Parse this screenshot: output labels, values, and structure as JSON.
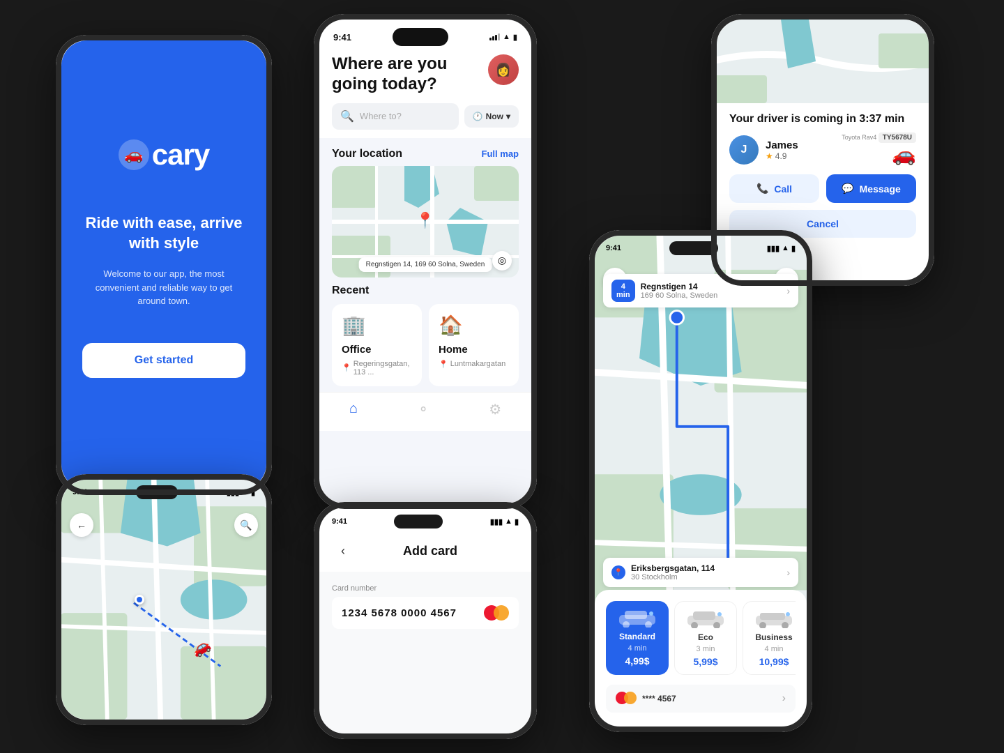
{
  "app": {
    "name": "cary"
  },
  "splash": {
    "tagline": "Ride with ease,\narrive with style",
    "subtitle": "Welcome to our app, the most convenient and reliable way to get around town.",
    "cta": "Get started"
  },
  "home": {
    "greeting": "Where are you\ngoing today?",
    "search_placeholder": "Where to?",
    "now_label": "Now",
    "location_title": "Your location",
    "full_map": "Full map",
    "address": "Regnstigen 14, 169 60 Solna, Sweden",
    "recent_title": "Recent",
    "recent_items": [
      {
        "icon": "🏢",
        "name": "Office",
        "address": "Regeringsgatan, 113 ..."
      },
      {
        "icon": "🏠",
        "name": "Home",
        "address": "Luntmakargatan"
      }
    ]
  },
  "driver_screen": {
    "title": "Your driver is coming in 3:37 min",
    "driver_name": "James",
    "driver_rating": "4.9",
    "car_model": "Toyota Rav4",
    "plate": "TY5678U",
    "call_label": "Call",
    "message_label": "Message",
    "cancel_label": "Cancel"
  },
  "route_screen": {
    "origin_street": "Regnstigen 14",
    "origin_city": "169 60 Solna, Sweden",
    "dest_street": "Eriksbergsgatan, 114",
    "dest_city": "30 Stockholm",
    "eta_minutes": "4",
    "eta_unit": "min",
    "vehicles": [
      {
        "name": "Standard",
        "time": "4 min",
        "price": "4,99$",
        "selected": true
      },
      {
        "name": "Eco",
        "time": "3 min",
        "price": "5,99$",
        "selected": false
      },
      {
        "name": "Business",
        "time": "4 min",
        "price": "10,99$",
        "selected": false
      }
    ],
    "card_number": "**** 4567"
  },
  "addcard": {
    "title": "Add card",
    "field_label": "Card number",
    "card_number": "1234 5678 0000 4567"
  },
  "status_bar": {
    "time": "9:41",
    "signal": "●●●",
    "wifi": "wifi",
    "battery": "battery"
  },
  "colors": {
    "primary": "#2563EB",
    "bg_blue": "#2563EB",
    "bg_dark": "#1a1a1a",
    "map_green": "#c8dfc8",
    "map_water": "#80c8d0"
  }
}
